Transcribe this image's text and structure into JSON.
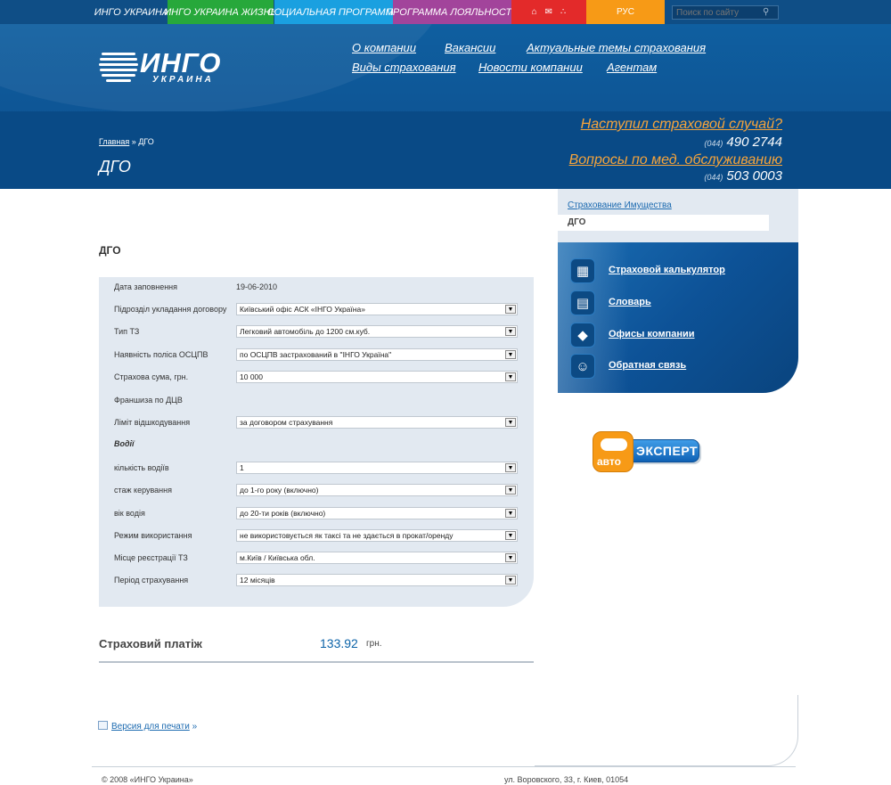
{
  "topbar": {
    "tabs": [
      {
        "label": "ИНГО УКРАИНА",
        "color": "#0f4e86"
      },
      {
        "label": "ИНГО УКРАИНА ЖИЗНЬ",
        "color": "#27a83b"
      },
      {
        "label": "СОЦИАЛЬНАЯ ПРОГРАММА",
        "color": "#1aa0e0"
      },
      {
        "label": "ПРОГРАММА ЛОЯЛЬНОСТИ",
        "color": "#a2449b"
      }
    ],
    "icons": [
      "home-icon",
      "mail-icon",
      "sitemap-icon"
    ],
    "lang_label": "РУС",
    "search": {
      "placeholder": "Поиск по сайту"
    }
  },
  "logo": {
    "name": "ИНГО",
    "subtitle": "УКРАИНА"
  },
  "nav": {
    "row1": [
      "О компании",
      "Вакансии",
      "Актуальные темы страхования"
    ],
    "row2": [
      "Виды страхования",
      "Новости компании",
      "Агентам"
    ]
  },
  "breadcrumb": {
    "home": "Главная",
    "sep": "»",
    "current": "ДГО"
  },
  "page": {
    "title": "ДГО",
    "section_heading": "ДГО"
  },
  "hotline": {
    "link1": "Наступил страховой случай?",
    "phone1_code": "(044)",
    "phone1": "490 2744",
    "link2": "Вопросы по мед. обслуживанию",
    "phone2_code": "(044)",
    "phone2": "503 0003"
  },
  "form": {
    "rows": [
      {
        "label": "Дата заповнення",
        "value": "19-06-2010",
        "type": "text"
      },
      {
        "label": "Підрозділ укладання договору",
        "value": "Київський офіс АСК «ІНГО Україна»",
        "type": "select"
      },
      {
        "label": "Тип ТЗ",
        "value": "Легковий автомобіль до 1200 см.куб.",
        "type": "select"
      },
      {
        "label": "Наявність поліса ОСЦПВ",
        "value": "по ОСЦПВ застрахований в \"ІНГО Україна\"",
        "type": "select"
      },
      {
        "label": "Страхова сума, грн.",
        "value": "10 000",
        "type": "select"
      },
      {
        "label": "Франшиза по ДЦВ",
        "value": "",
        "type": "text"
      },
      {
        "label": "Ліміт відшкодування",
        "value": "за договором страхування",
        "type": "select"
      },
      {
        "label": "Водії",
        "value": "",
        "type": "subheading"
      },
      {
        "label": "кількість водіїв",
        "value": "1",
        "type": "select"
      },
      {
        "label": "стаж керування",
        "value": "до 1-го року (включно)",
        "type": "select"
      },
      {
        "label": "вік водія",
        "value": "до 20-ти років (включно)",
        "type": "select"
      },
      {
        "label": "Режим використання",
        "value": "не використовується як таксі та не здається в прокат/оренду",
        "type": "select"
      },
      {
        "label": "Місце реєстрації ТЗ",
        "value": "м.Київ / Київська обл.",
        "type": "select"
      },
      {
        "label": "Період страхування",
        "value": "12 місяців",
        "type": "select"
      }
    ]
  },
  "payment": {
    "label": "Страховий платіж",
    "value": "133.92",
    "unit": "грн."
  },
  "print": {
    "label": "Версия для печати",
    "suffix": "»"
  },
  "sidebar": {
    "parent_link": "Страхование Имущества",
    "current": "ДГО",
    "tools": [
      {
        "label": "Страховой калькулятор",
        "icon": "calculator-icon",
        "glyph": "▦"
      },
      {
        "label": "Словарь",
        "icon": "document-icon",
        "glyph": "▤"
      },
      {
        "label": "Офисы компании",
        "icon": "map-icon",
        "glyph": "◆"
      },
      {
        "label": "Обратная связь",
        "icon": "person-icon",
        "glyph": "☺"
      }
    ],
    "autoexpert": {
      "left": "авто",
      "right": "ЭКСПЕРТ"
    }
  },
  "footer": {
    "copyright": "© 2008 «ИНГО Украина»",
    "address": "ул. Воровского, 33, г. Киев, 01054"
  },
  "colors": {
    "brand_blue": "#0f4e86",
    "accent_orange": "#f6a43b",
    "link_blue": "#1c6ab0"
  }
}
